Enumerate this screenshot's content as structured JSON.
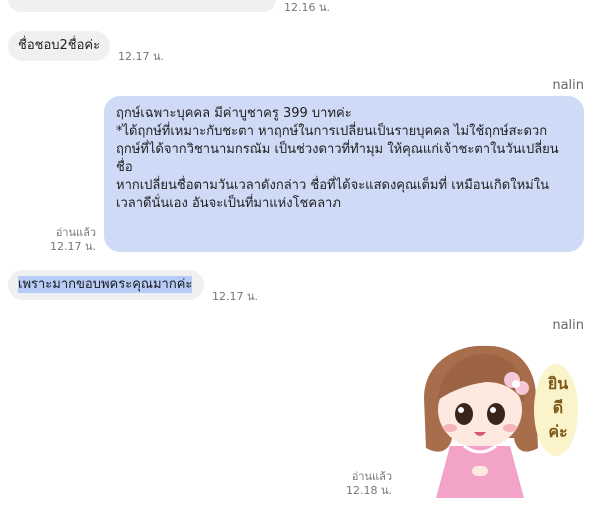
{
  "messages": [
    {
      "id": "m0",
      "time": "12.16 น."
    },
    {
      "id": "m1",
      "text": "ชื่อชอบ2ชื่อค่ะ",
      "time": "12.17 น."
    },
    {
      "id": "m2",
      "sender": "nalin",
      "lines": [
        "ฤกษ์เฉพาะบุคคล มีค่าบูชาครู 399 บาทค่ะ",
        "",
        "",
        "*ได้ฤกษ์ที่เหมาะกับชะตา หาฤกษ์ในการเปลี่ยนเป็นรายบุคคล ไม่ใช้ฤกษ์สะดวก",
        "ฤกษ์ที่ได้จากวิชานามกรณัม เป็นช่วงดาวที่ทำมุม ให้คุณแก่เจ้าชะตาในวันเปลี่ยน",
        "ชื่อ",
        "หากเปลี่ยนชื่อตามวันเวลาดังกล่าว ชื่อที่ได้จะแสดงคุณเต็มที่ เหมือนเกิดใหม่ใน",
        "เวลาดีนั่นเอง อันจะเป็นที่มาแห่งโชคลาภ"
      ],
      "read_label": "อ่านแล้ว",
      "time": "12.17 น."
    },
    {
      "id": "m3",
      "text": "เพราะมากขอบพคระคุณมากค่ะ",
      "time": "12.17 น."
    },
    {
      "id": "m4",
      "sender": "nalin",
      "sticker_text": [
        "ยิน",
        "ดี",
        "ค่ะ"
      ],
      "read_label": "อ่านแล้ว",
      "time": "12.18 น."
    }
  ],
  "colors": {
    "incoming_bubble": "#eef0f2",
    "outgoing_bubble": "#cfdaf6",
    "selection_highlight": "#b7cdf7",
    "sticker_dress": "#f3a3c8",
    "sticker_hair": "#a86e4c"
  }
}
